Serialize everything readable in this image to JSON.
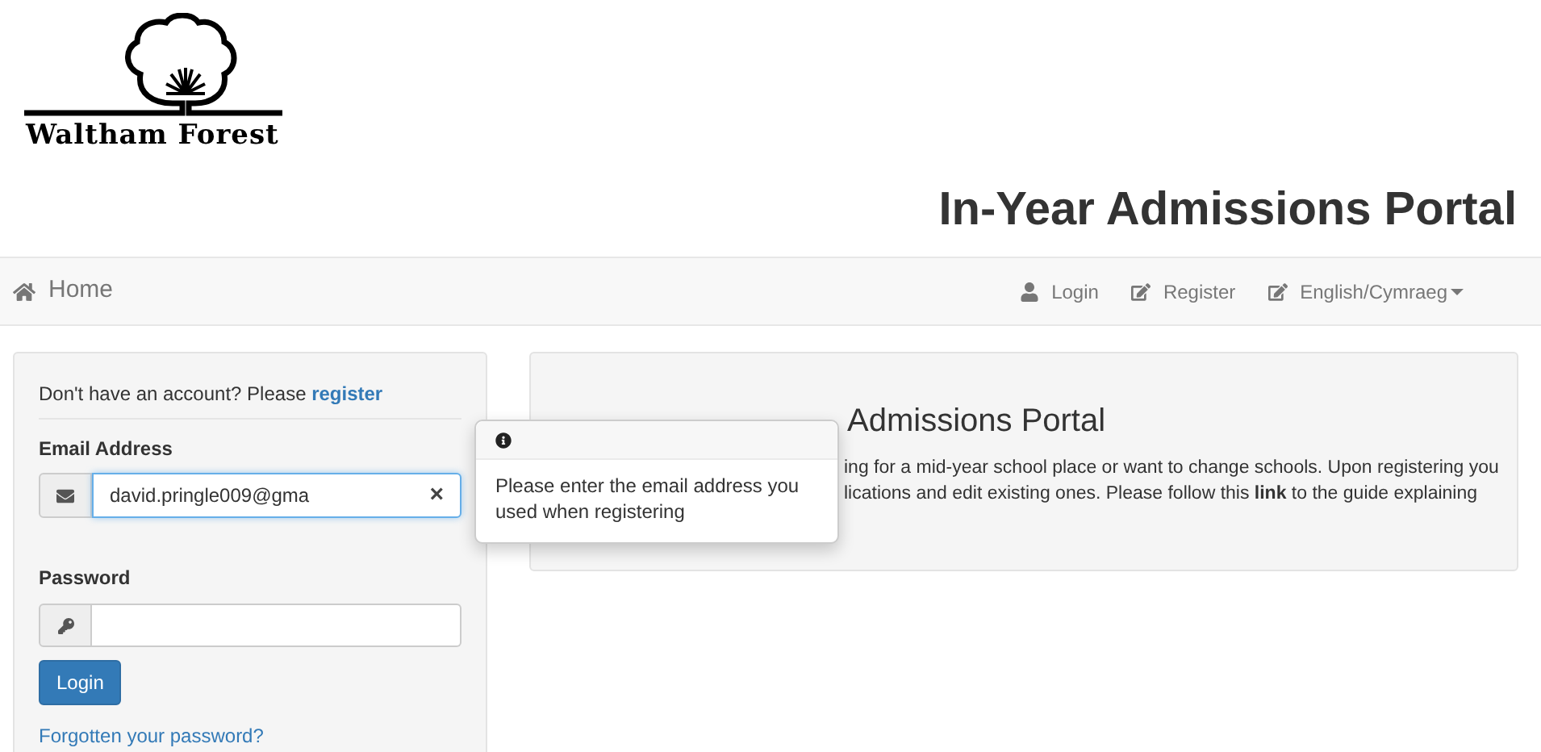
{
  "logo": {
    "text": "Waltham Forest"
  },
  "page_title": "In-Year Admissions Portal",
  "navbar": {
    "home": "Home",
    "links": [
      {
        "kind": "user",
        "label": "Login"
      },
      {
        "kind": "edit",
        "label": "Register"
      },
      {
        "kind": "edit-dropdown",
        "label": "English/Cymraeg"
      }
    ]
  },
  "login_panel": {
    "prompt": "Don't have an account? Please ",
    "register_link": "register",
    "email_label": "Email Address",
    "email_value": "david.pringle009@gma",
    "clear": "×",
    "password_label": "Password",
    "login_button": "Login",
    "forgot_link": "Forgotten your password?"
  },
  "popover": {
    "text": "Please enter the email address you used when registering"
  },
  "welcome": {
    "heading": "Admissions Portal",
    "lines": [
      "ing for a mid-year school place or want to change schools. Upon registering you",
      "lications and edit existing ones. Please follow this **link** to the guide explaining"
    ]
  }
}
